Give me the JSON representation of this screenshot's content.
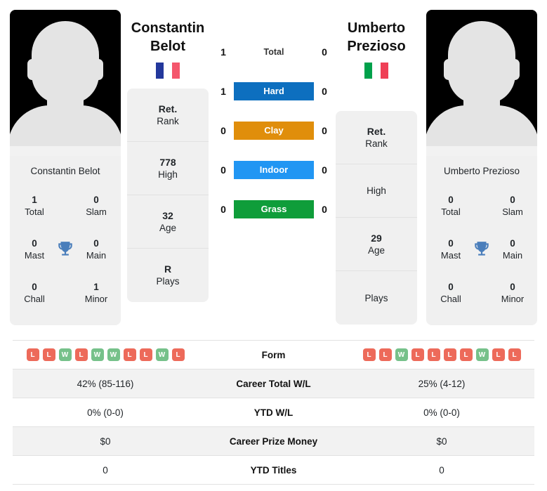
{
  "players": [
    {
      "first_name": "Constantin",
      "last_name": "Belot",
      "full_name": "Constantin Belot",
      "flag": {
        "name": "france-flag",
        "colors": [
          "#23389c",
          "#ffffff",
          "#f4566c"
        ]
      },
      "card_stats": [
        {
          "value": "1",
          "label": "Total"
        },
        {
          "value": "0",
          "label": "Slam"
        },
        {
          "value": "0",
          "label": "Mast"
        },
        {
          "value": "0",
          "label": "Main"
        },
        {
          "value": "0",
          "label": "Chall"
        },
        {
          "value": "1",
          "label": "Minor"
        }
      ],
      "rank_items": [
        {
          "value": "Ret.",
          "label": "Rank"
        },
        {
          "value": "778",
          "label": "High"
        },
        {
          "value": "32",
          "label": "Age"
        },
        {
          "value": "R",
          "label": "Plays"
        }
      ],
      "form": [
        "L",
        "L",
        "W",
        "L",
        "W",
        "W",
        "L",
        "L",
        "W",
        "L"
      ]
    },
    {
      "first_name": "Umberto",
      "last_name": "Prezioso",
      "full_name": "Umberto Prezioso",
      "flag": {
        "name": "italy-flag",
        "colors": [
          "#00a14b",
          "#ffffff",
          "#ef4056"
        ]
      },
      "card_stats": [
        {
          "value": "0",
          "label": "Total"
        },
        {
          "value": "0",
          "label": "Slam"
        },
        {
          "value": "0",
          "label": "Mast"
        },
        {
          "value": "0",
          "label": "Main"
        },
        {
          "value": "0",
          "label": "Chall"
        },
        {
          "value": "0",
          "label": "Minor"
        }
      ],
      "rank_items": [
        {
          "value": "Ret.",
          "label": "Rank"
        },
        {
          "value": "",
          "label": "High"
        },
        {
          "value": "29",
          "label": "Age"
        },
        {
          "value": "",
          "label": "Plays"
        }
      ],
      "form": [
        "L",
        "L",
        "W",
        "L",
        "L",
        "L",
        "L",
        "W",
        "L",
        "L"
      ]
    }
  ],
  "head_to_head": [
    {
      "left": "1",
      "label": "Total",
      "right": "0",
      "type": "text",
      "color": ""
    },
    {
      "left": "1",
      "label": "Hard",
      "right": "0",
      "type": "badge",
      "color": "#0d6fbf"
    },
    {
      "left": "0",
      "label": "Clay",
      "right": "0",
      "type": "badge",
      "color": "#e08e0b"
    },
    {
      "left": "0",
      "label": "Indoor",
      "right": "0",
      "type": "badge",
      "color": "#2196f3"
    },
    {
      "left": "0",
      "label": "Grass",
      "right": "0",
      "type": "badge",
      "color": "#0f9d3a"
    }
  ],
  "comparison_table": [
    {
      "label": "Form",
      "left": "",
      "right": "",
      "kind": "form",
      "shaded": false
    },
    {
      "label": "Career Total W/L",
      "left": "42% (85-116)",
      "right": "25% (4-12)",
      "kind": "text",
      "shaded": true
    },
    {
      "label": "YTD W/L",
      "left": "0% (0-0)",
      "right": "0% (0-0)",
      "kind": "text",
      "shaded": false
    },
    {
      "label": "Career Prize Money",
      "left": "$0",
      "right": "$0",
      "kind": "text",
      "shaded": true
    },
    {
      "label": "YTD Titles",
      "left": "0",
      "right": "0",
      "kind": "text",
      "shaded": false
    }
  ],
  "icons": {
    "trophy": "trophy-icon",
    "avatar": "player-avatar-silhouette"
  },
  "colors": {
    "win": "#76c18a",
    "loss": "#ed6a5a",
    "card_bg": "#f0f0f0",
    "row_shade": "#f2f2f2"
  }
}
